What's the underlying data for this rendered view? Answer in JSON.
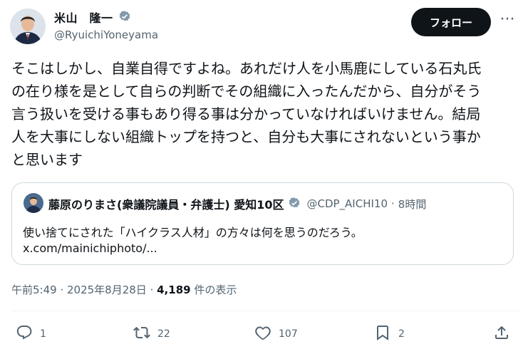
{
  "author": {
    "name": "米山　隆一",
    "handle": "@RyuichiYoneyama",
    "verified": true
  },
  "header": {
    "follow_label": "フォロー",
    "more_label": "···"
  },
  "post": {
    "text": "そこはしかし、自業自得ですよね。あれだけ人を小馬鹿にしている石丸氏\nの在り様を是として自らの判断でその組織に入ったんだから、自分がそう\n言う扱いを受ける事もあり得る事は分かっていなければいけません。結局\n人を大事にしない組織トップを持つと、自分も大事にされないという事か\nと思います"
  },
  "quoted": {
    "name": "藤原のりまさ(衆議院議員・弁護士) 愛知10区",
    "handle": "@CDP_AICHI10",
    "separator": "·",
    "time": "8時間",
    "text": "使い捨てにされた「ハイクラス人材」の方々は何を思うのだろう。",
    "link": "x.com/mainichiphoto/..."
  },
  "meta": {
    "time": "午前5:49",
    "sep1": " · ",
    "date": "2025年8月28日",
    "sep2": " · ",
    "views": "4,189",
    "views_label": " 件の表示"
  },
  "actions": {
    "replies": "1",
    "reposts": "22",
    "likes": "107",
    "bookmarks": "2"
  },
  "colors": {
    "text": "#0f1419",
    "secondary": "#536471",
    "verified": "#829aab",
    "border": "#cfd9de"
  }
}
